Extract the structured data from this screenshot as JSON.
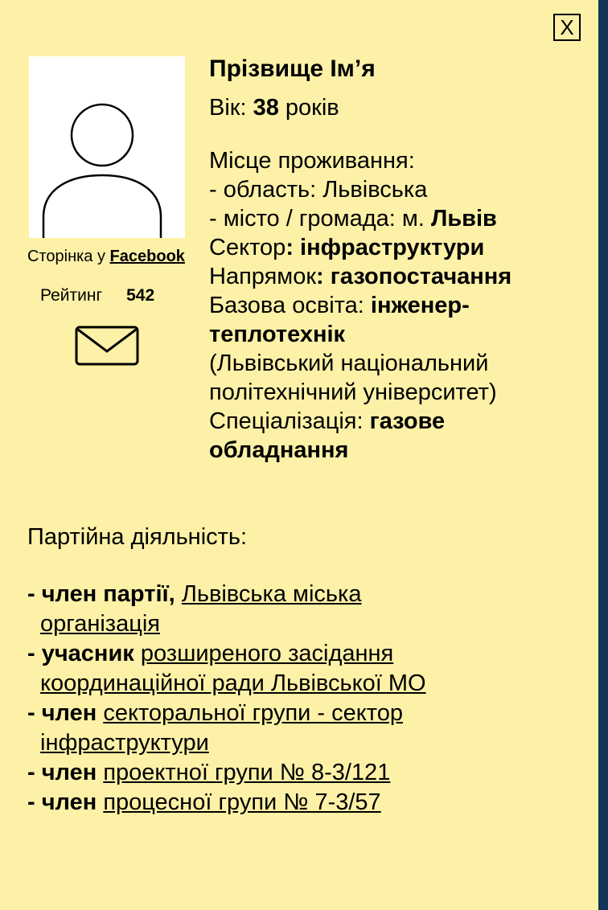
{
  "profile": {
    "name": "Прізвище Ім’я",
    "age_label": "Вік: ",
    "age_value": "38",
    "age_unit": " років",
    "residence_label": "Місце проживання:",
    "region_line": "- область: Львівська",
    "city_prefix": "- місто / громада: м. ",
    "city_value": "Львів",
    "sector_label": "Сектор",
    "sector_value": ": інфраструктури",
    "direction_label": "Напрямок",
    "direction_value": ": газопостачання",
    "education_label": "Базова освіта: ",
    "education_value_1": "інженер-",
    "education_value_2": "теплотехнік",
    "university_1": "(Львівський національний",
    "university_2": "політехнічний університет)",
    "specialization_label": "Спеціалізація: ",
    "specialization_value_1": "газове",
    "specialization_value_2": "обладнання"
  },
  "sidebar": {
    "facebook_prefix": "Сторінка у ",
    "facebook_link": "Facebook",
    "rating_label": "Рейтинг",
    "rating_value": "542"
  },
  "close_label": "X",
  "party": {
    "title": "Партійна діяльність:",
    "items": [
      {
        "role": "- член партії,",
        "link_1": "Львівська міська",
        "link_2": "організація"
      },
      {
        "role": "- учасник",
        "link_1": "розширеного засідання",
        "link_2": "координаційної ради Львівської МО"
      },
      {
        "role": "- член",
        "link_1": "секторальної групи - сектор",
        "link_2": "інфраструктури"
      },
      {
        "role": "- член",
        "link_1": "проектної групи № 8-3/121"
      },
      {
        "role": "- член",
        "link_1": "процесної групи № 7-3/57"
      }
    ]
  },
  "colors": {
    "card_bg": "#fdf1a7",
    "edge": "#123456"
  },
  "icons": [
    "close-icon",
    "avatar-icon",
    "mail-icon"
  ]
}
